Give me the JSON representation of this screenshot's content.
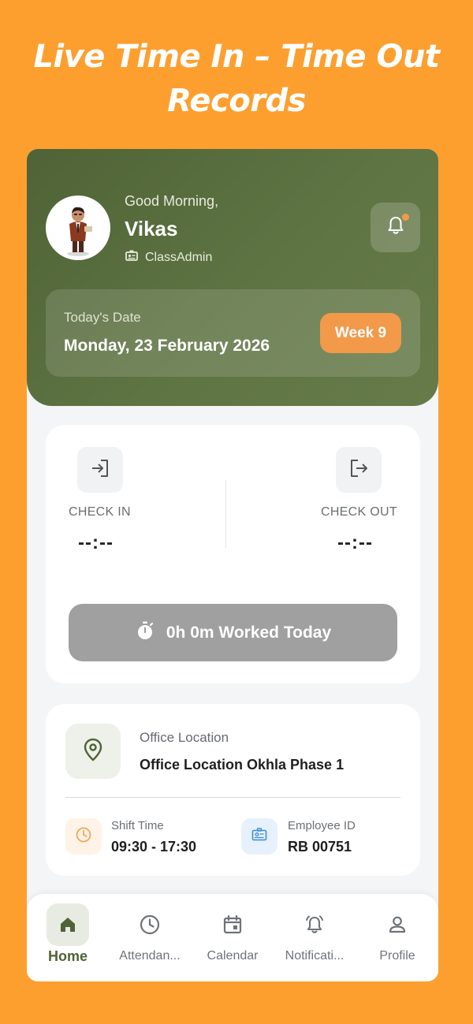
{
  "promo": {
    "title": "Live Time In – Time Out Records"
  },
  "header": {
    "greeting": "Good Morning,",
    "user_name": "Vikas",
    "role": "ClassAdmin",
    "date_label": "Today's Date",
    "date_value": "Monday, 23 February 2026",
    "week_badge": "Week 9"
  },
  "attendance": {
    "check_in_label": "CHECK IN",
    "check_in_time": "--:--",
    "check_out_label": "CHECK OUT",
    "check_out_time": "--:--",
    "worked_text": "0h 0m Worked Today"
  },
  "info": {
    "location_label": "Office Location",
    "location_value": "Office Location Okhla Phase 1",
    "shift_label": "Shift Time",
    "shift_value": "09:30 - 17:30",
    "employee_label": "Employee ID",
    "employee_value": "RB 00751"
  },
  "nav": {
    "items": [
      {
        "label": "Home",
        "icon": "home-icon"
      },
      {
        "label": "Attendan...",
        "icon": "clock-icon"
      },
      {
        "label": "Calendar",
        "icon": "calendar-icon"
      },
      {
        "label": "Notificati...",
        "icon": "bell-icon"
      },
      {
        "label": "Profile",
        "icon": "person-icon"
      }
    ]
  },
  "colors": {
    "background": "#FD9F2F",
    "header_green": "#5A6E3F",
    "accent_orange": "#F2994A",
    "worked_button": "#A0A0A0"
  }
}
